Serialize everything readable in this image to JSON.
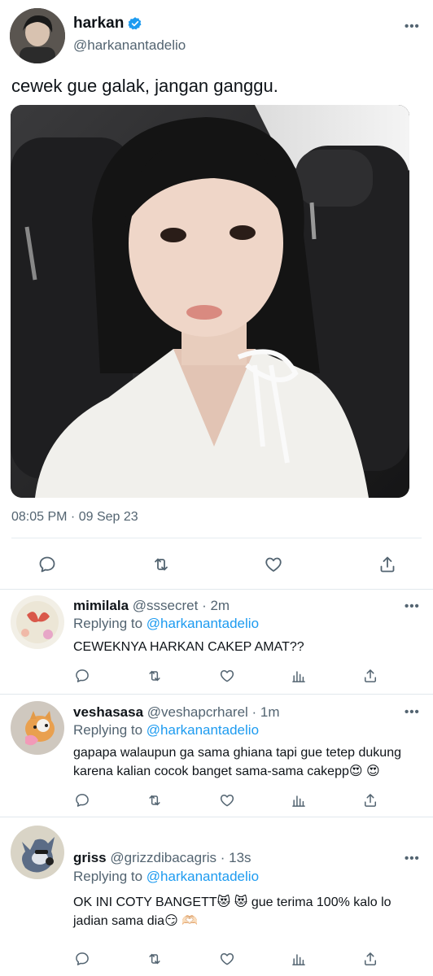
{
  "post": {
    "author_name": "harkan",
    "author_handle": "@harkanantadelio",
    "text": "cewek gue galak, jangan ganggu.",
    "timestamp": "08:05 PM · 09 Sep 23",
    "more_label": "•••"
  },
  "replies": [
    {
      "name": "mimilala",
      "handle": "@sssecret",
      "dot": " · ",
      "time": "2m",
      "replying_prefix": "Replying to ",
      "replying_to": "@harkanantadelio",
      "text": "CEWEKNYA HARKAN CAKEP AMAT??",
      "more_label": "•••"
    },
    {
      "name": "veshasasa",
      "handle": "@veshapcrharel",
      "dot": " · ",
      "time": "1m",
      "replying_prefix": "Replying to ",
      "replying_to": "@harkanantadelio",
      "text": "gapapa walaupun ga sama ghiana tapi gue tetep dukung karena kalian cocok banget sama-sama cakepp😍 😍",
      "more_label": "•••"
    },
    {
      "name": "griss",
      "handle": "@grizzdibacagris",
      "dot": " · ",
      "time": "13s",
      "replying_prefix": "Replying to ",
      "replying_to": "@harkanantadelio",
      "text": "OK INI COTY BANGETT😻 😻  gue terima 100% kalo lo jadian sama dia😏 🫶🏻",
      "more_label": "•••"
    }
  ],
  "colors": {
    "accent": "#1d9bf0",
    "secondary_text": "#536471",
    "verified": "#1d9bf0"
  }
}
